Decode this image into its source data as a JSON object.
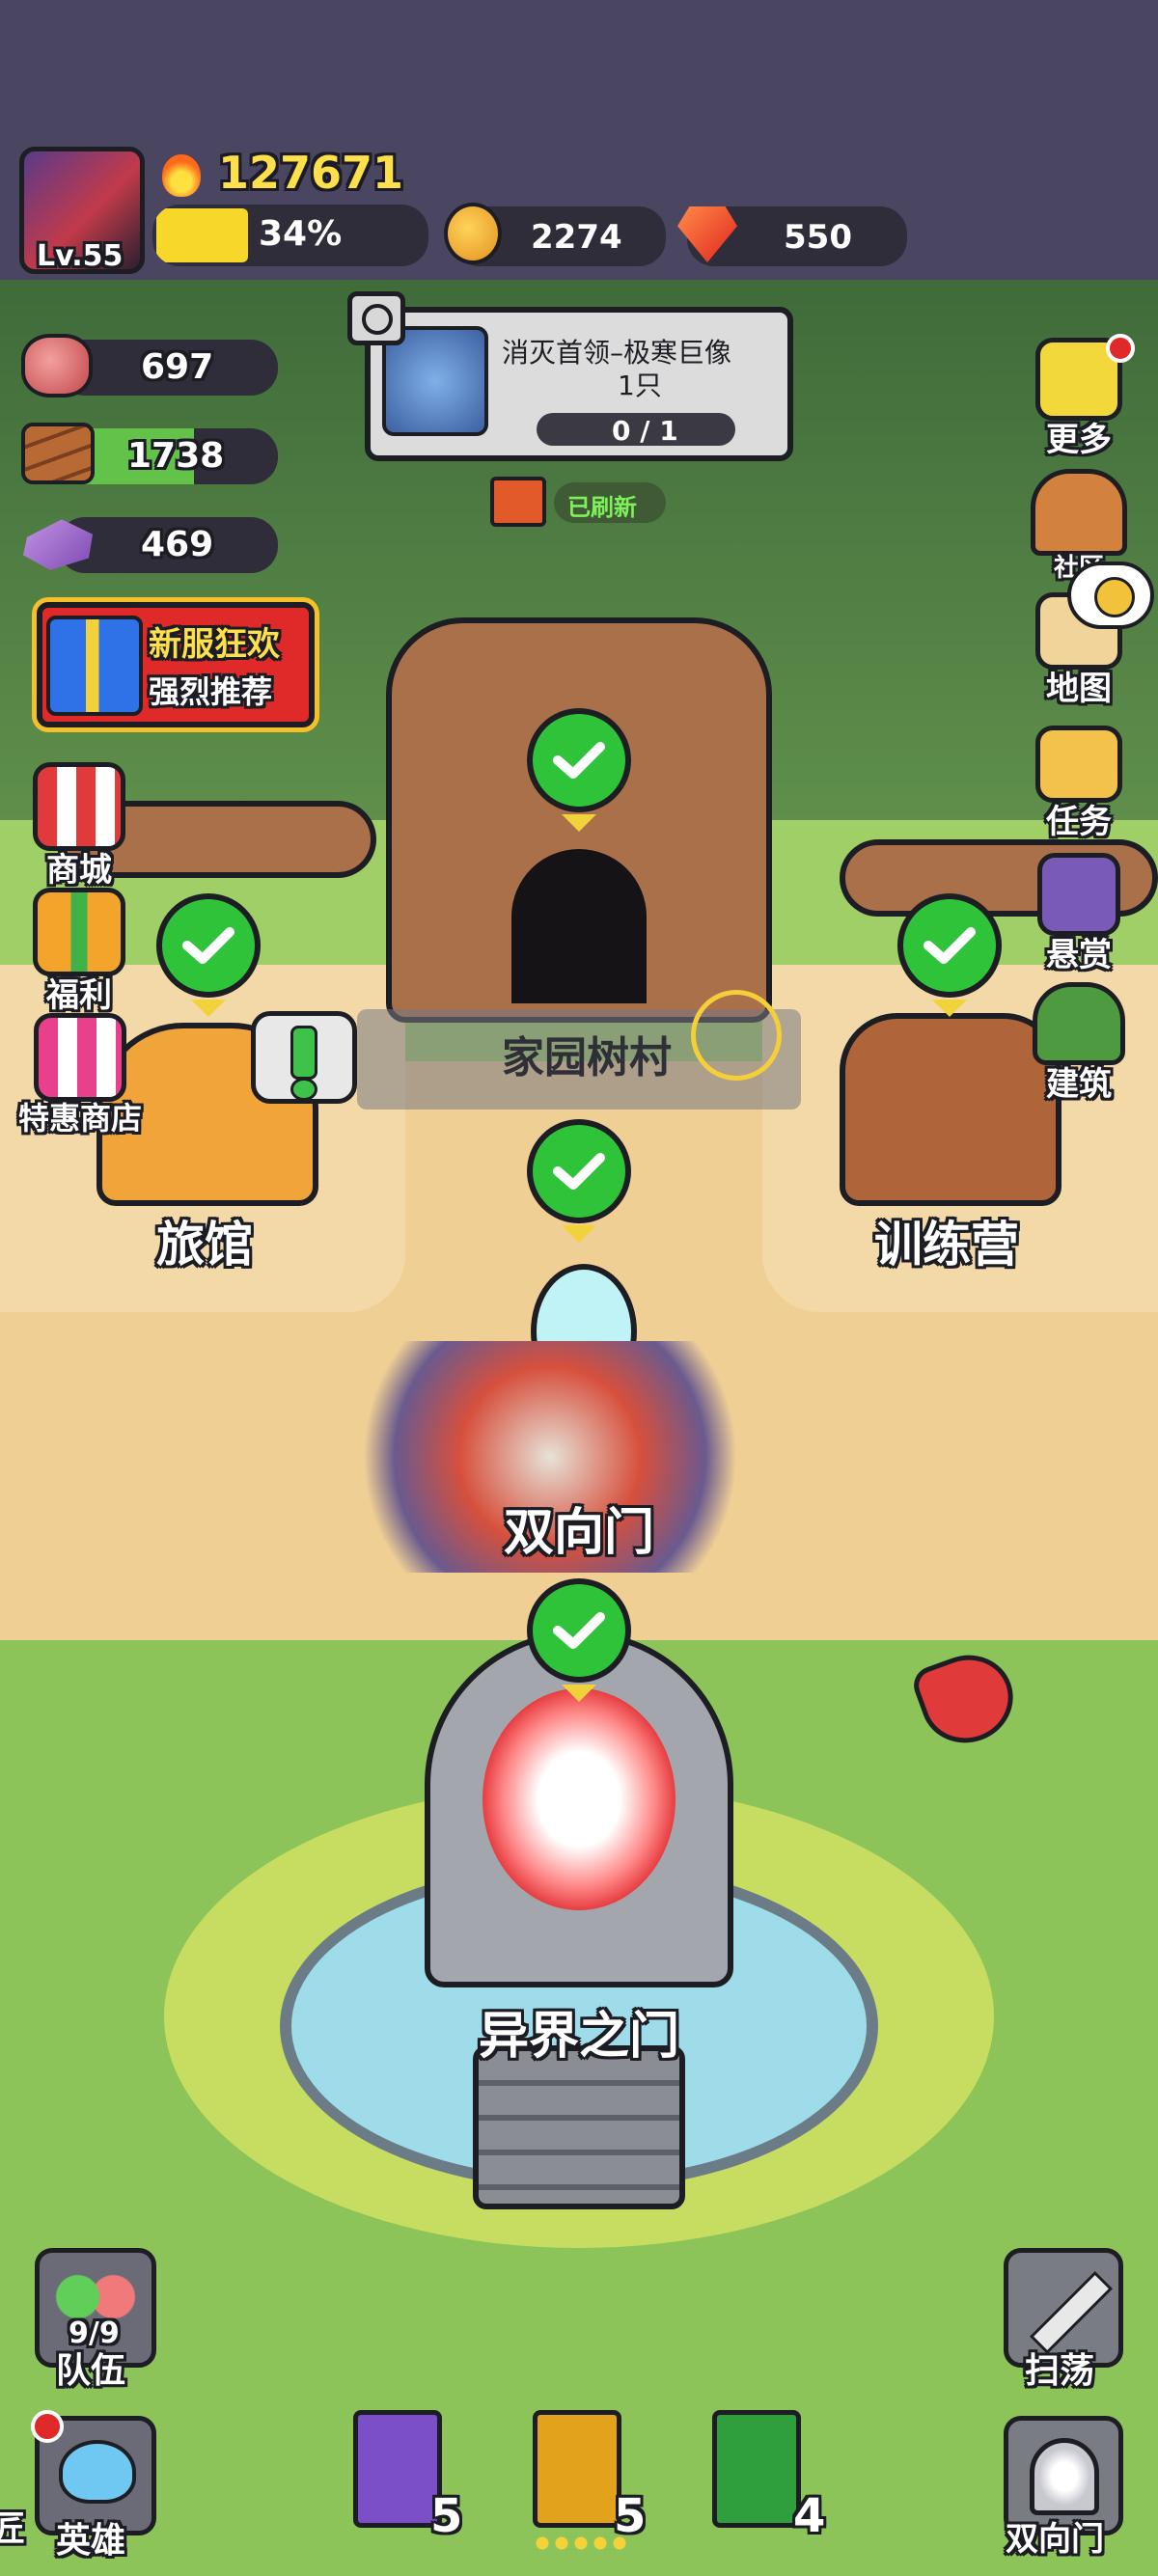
{
  "player": {
    "level": "Lv.55",
    "power": "127671",
    "exp_percent_label": "34%",
    "exp_fraction": 0.34
  },
  "currency": {
    "gold": "2274",
    "gems": "550"
  },
  "resources": [
    {
      "name": "meat-icon",
      "value": "697",
      "fill": 0.08
    },
    {
      "name": "wood-icon",
      "value": "1738",
      "fill": 0.62
    },
    {
      "name": "ore-icon",
      "value": "469",
      "fill": 0.0
    }
  ],
  "quest": {
    "title": "消灭首领–极寒巨像",
    "subtitle": "1只",
    "progress": "0 / 1",
    "refresh_label": "已刷新"
  },
  "promo": {
    "line1": "新服狂欢",
    "line2": "强烈推荐"
  },
  "left_menu": [
    {
      "label": "商城"
    },
    {
      "label": "福利"
    },
    {
      "label": "特惠商店"
    }
  ],
  "right_menu": [
    {
      "label": "更多"
    },
    {
      "label": "社区"
    },
    {
      "label": "地图"
    },
    {
      "label": "任务"
    },
    {
      "label": "悬赏"
    },
    {
      "label": "建筑"
    }
  ],
  "map": {
    "village_name": "家园树村",
    "inn": "旅馆",
    "training": "训练营",
    "twoway_gate": "双向门",
    "otherworld_gate": "异界之门"
  },
  "bottom_left": {
    "team_label": "队伍",
    "team_count": "9/9",
    "hero_label": "英雄",
    "edge_label": "匠"
  },
  "books": [
    {
      "count": "5",
      "color": "#7b4fc7"
    },
    {
      "count": "5",
      "color": "#e3a21c"
    },
    {
      "count": "4",
      "color": "#2f9e3c"
    }
  ],
  "bottom_right": {
    "sweep_label": "扫荡",
    "gate_label": "双向门"
  },
  "colors": {
    "header_bg": "#4a4561",
    "grass": "#8cc45a",
    "path": "#f0cf95",
    "check_green": "#2fc33a"
  }
}
